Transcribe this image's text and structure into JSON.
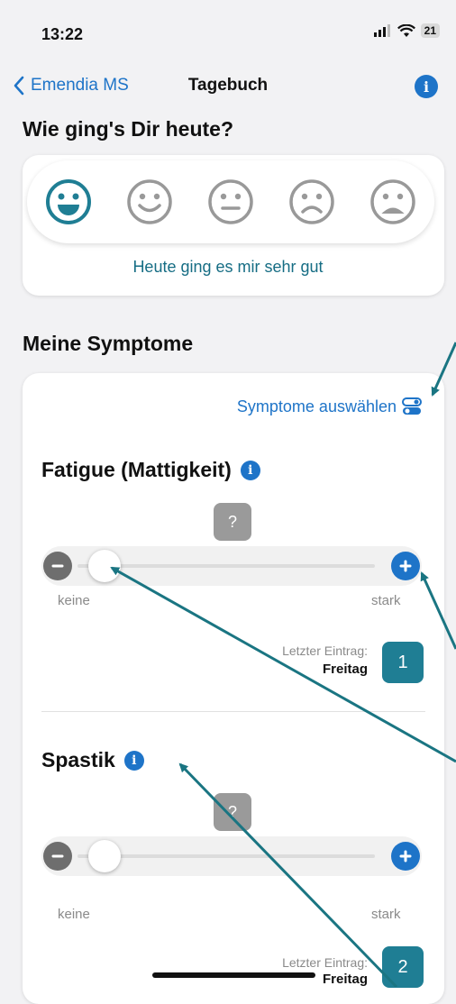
{
  "status": {
    "time": "13:22",
    "battery": "21"
  },
  "nav": {
    "back_label": "Emendia MS",
    "title": "Tagebuch"
  },
  "mood": {
    "question": "Wie ging's Dir heute?",
    "options": [
      "very-happy-face-icon",
      "happy-face-icon",
      "neutral-face-icon",
      "sad-face-icon",
      "very-sad-face-icon"
    ],
    "selected_index": 0,
    "selected_label": "Heute ging es mir sehr gut"
  },
  "symptoms": {
    "section_title": "Meine Symptome",
    "select_link": "Symptome auswählen",
    "items": [
      {
        "name": "Fatigue (Mattigkeit)",
        "value_badge": "?",
        "scale_min": "keine",
        "scale_max": "stark",
        "last_entry_label": "Letzter Eintrag:",
        "last_entry_day": "Freitag",
        "count": "1",
        "level": 0
      },
      {
        "name": "Spastik",
        "value_badge": "?",
        "scale_min": "keine",
        "scale_max": "stark",
        "last_entry_label": "Letzter Eintrag:",
        "last_entry_day": "Freitag",
        "count": "2",
        "level": 0
      }
    ]
  },
  "colors": {
    "accent_blue": "#1e74c8",
    "teal": "#1f7e94",
    "mood_selected": "#166d84",
    "annotation_arrow": "#1a7582"
  }
}
